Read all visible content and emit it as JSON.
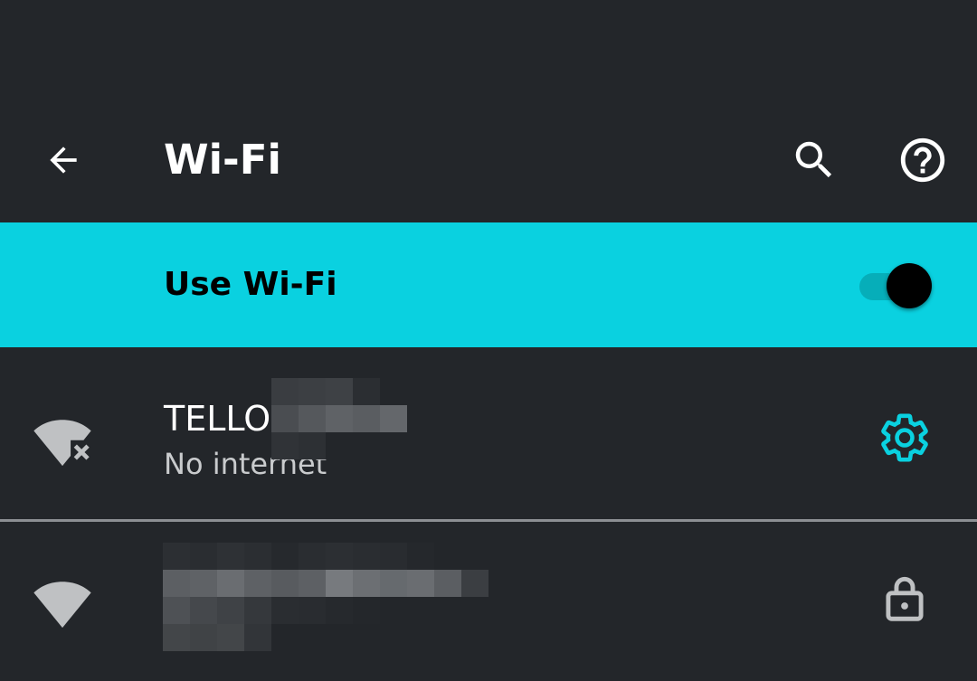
{
  "app_bar": {
    "title": "Wi-Fi",
    "back_icon": "arrow-back-icon",
    "search_icon": "search-icon",
    "help_icon": "help-circle-icon"
  },
  "master_switch": {
    "label": "Use Wi-Fi",
    "checked": true,
    "background_color": "#0ad1e0"
  },
  "networks": [
    {
      "ssid": "TELLO-",
      "summary": "No internet",
      "signal_icon": "wifi-no-internet-icon",
      "action_icon": "settings-gear-icon",
      "accent_color": "#0ad1e0"
    },
    {
      "ssid": "",
      "summary": "",
      "signal_icon": "wifi-full-icon",
      "action_icon": "lock-icon"
    }
  ],
  "colors": {
    "background": "#23262a",
    "accent": "#0ad1e0",
    "text_primary": "#ffffff",
    "text_secondary": "#c9cbcd",
    "icon_gray": "#bfc1c3"
  }
}
